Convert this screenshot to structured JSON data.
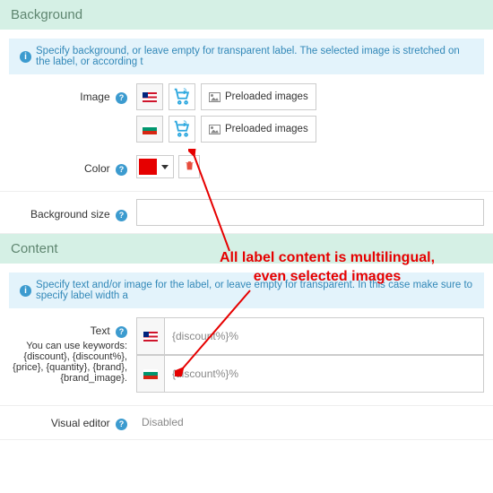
{
  "sections": {
    "background": {
      "title": "Background",
      "info": "Specify background, or leave empty for transparent label. The selected image is stretched on the label, or according t"
    },
    "content": {
      "title": "Content",
      "info": "Specify text and/or image for the label, or leave empty for transparent. In this case make sure to specify label width a"
    }
  },
  "labels": {
    "image": "Image",
    "color": "Color",
    "bgsize": "Background size",
    "text": "Text",
    "keywords": "You can use keywords: {discount}, {discount%}, {price}, {quantity}, {brand}, {brand_image}.",
    "visual_editor": "Visual editor",
    "preloaded": "Preloaded images"
  },
  "values": {
    "color": "#e60000",
    "text_en": "{discount%}%",
    "text_bg": "{discount%}%",
    "visual_editor": "Disabled"
  },
  "annotation": {
    "line1": "All label content is multilingual,",
    "line2": "even selected images"
  }
}
